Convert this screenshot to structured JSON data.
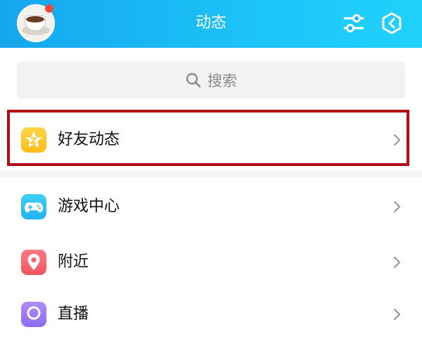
{
  "header": {
    "title": "动态",
    "filter_icon": "sliders-icon",
    "right_icon": "hexagon-shield-icon",
    "gradient": [
      "#16a6ee",
      "#20d2fb"
    ]
  },
  "search": {
    "placeholder": "搜索",
    "icon": "search-icon"
  },
  "list": {
    "items": [
      {
        "label": "好友动态",
        "icon": "friend-feed-star-icon",
        "color": "#ffc82e",
        "highlighted": true
      },
      {
        "label": "游戏中心",
        "icon": "gamepad-icon",
        "color": "#2ec0f7"
      },
      {
        "label": "附近",
        "icon": "location-pin-icon",
        "color": "#f4606a"
      },
      {
        "label": "直播",
        "icon": "live-icon",
        "color": "#9c78f8"
      }
    ]
  },
  "annotation": {
    "highlight_color": "#b30c12"
  }
}
